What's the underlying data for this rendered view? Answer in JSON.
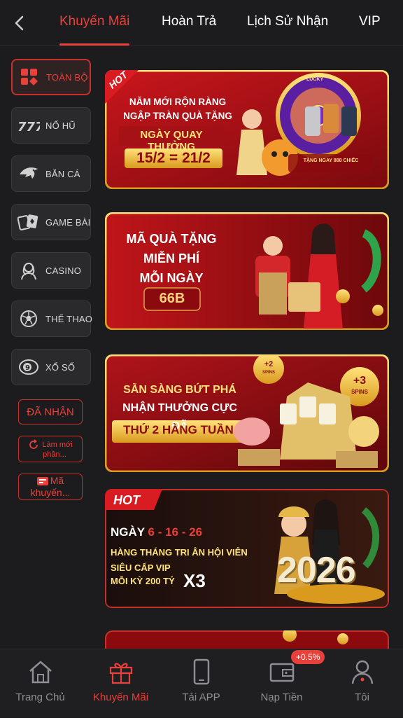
{
  "header": {
    "tabs": [
      {
        "label": "Khuyến Mãi",
        "active": true
      },
      {
        "label": "Hoàn Trả"
      },
      {
        "label": "Lịch Sử Nhận"
      },
      {
        "label": "VIP"
      }
    ]
  },
  "sidebar": {
    "categories": [
      {
        "label": "TOÀN BỘ",
        "icon": "grid-icon",
        "active": true
      },
      {
        "label": "NỔ HŨ",
        "icon": "slot-777-icon"
      },
      {
        "label": "BẮN CÁ",
        "icon": "shark-icon"
      },
      {
        "label": "GAME BÀI",
        "icon": "cards-icon"
      },
      {
        "label": "CASINO",
        "icon": "dealer-icon"
      },
      {
        "label": "THỂ THAO",
        "icon": "soccer-ball-icon"
      },
      {
        "label": "XỔ SỐ",
        "icon": "lottery-ball-icon"
      }
    ],
    "received_label": "ĐÃ NHẬN",
    "refresh_label_1": "Làm mới",
    "refresh_label_2": "phần...",
    "promo_code_label_1": "Mã",
    "promo_code_label_2": "khuyến..."
  },
  "banners": [
    {
      "badge": "HOT",
      "line1": "NĂM MỚI RỘN RÀNG",
      "line2": "NGẬP TRÀN QUÀ TẶNG",
      "line3": "NGÀY QUAY THƯỞNG",
      "dates": "15/2 = 21/2",
      "wheel_top": "LUCKY",
      "gift_text": "TẶNG NGAY 888 CHIẾC"
    },
    {
      "line1": "MÃ QUÀ TẶNG",
      "line2": "MIỄN PHÍ",
      "line3": "MỖI NGÀY",
      "amount": "66B"
    },
    {
      "line1": "SẴN SÀNG BỨT PHÁ",
      "line2": "NHẬN THƯỞNG CỰC ĐÃ",
      "line3": "THỨ 2 HÀNG TUẦN",
      "coin1": "+2",
      "coin1_sub": "SPINS",
      "coin2": "+3",
      "coin2_sub": "SPINS"
    },
    {
      "badge": "HOT",
      "day_prefix": "NGÀY",
      "days": "6 - 16 - 26",
      "line2": "HÀNG THÁNG TRI ÂN HỘI VIÊN",
      "line3": "SIÊU CẤP VIP",
      "line4": "MỖI KỲ 200 TỶ",
      "multiplier": "X3",
      "year": "2026"
    }
  ],
  "bottom_nav": [
    {
      "label": "Trang Chủ",
      "icon": "home-icon"
    },
    {
      "label": "Khuyến Mãi",
      "icon": "gift-icon",
      "active": true
    },
    {
      "label": "Tải APP",
      "icon": "phone-icon"
    },
    {
      "label": "Nạp Tiền",
      "icon": "wallet-icon"
    },
    {
      "label": "Tôi",
      "icon": "user-icon"
    }
  ],
  "deposit_badge": "+0.5%",
  "colors": {
    "accent": "#e8403a",
    "background": "#1c1c1e",
    "gold": "#f5c542"
  }
}
